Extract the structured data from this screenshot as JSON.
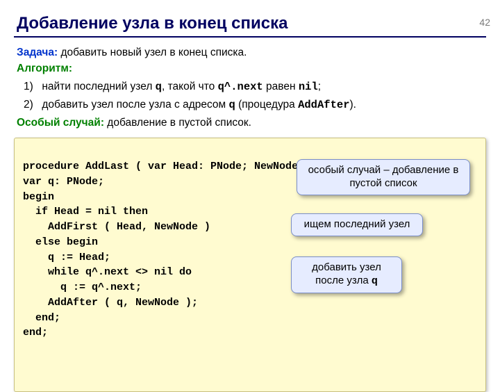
{
  "page_number": "42",
  "title": "Добавление узла в конец списка",
  "task": {
    "label": "Задача:",
    "text": " добавить новый узел в конец списка."
  },
  "algo_label": "Алгоритм:",
  "step1": {
    "num": "1)",
    "a": "найти последний узел ",
    "q": "q",
    "b": ", такой что ",
    "expr": "q^.next",
    "c": " равен ",
    "nil": "nil",
    "d": ";"
  },
  "step2": {
    "num": "2)",
    "a": "добавить узел после узла с адресом ",
    "q": "q",
    "b": " (процедура ",
    "proc": "AddAfter",
    "c": ")."
  },
  "special": {
    "label": "Особый случай:",
    "text": " добавление в пустой список."
  },
  "code": {
    "l01": "procedure AddLast ( var Head: PNode; NewNode: PNode );",
    "l02": "var q: PNode;",
    "l03": "begin",
    "l04": "  if Head = nil then",
    "l05": "    AddFirst ( Head, NewNode )",
    "l06": "  else begin",
    "l07": "    q := Head;",
    "l08": "    while q^.next <> nil do",
    "l09": "      q := q^.next;",
    "l10": "    AddAfter ( q, NewNode );",
    "l11": "  end;",
    "l12": "end;"
  },
  "callouts": {
    "c1": "особый случай – добавление в пустой список",
    "c2": "ищем последний узел",
    "c3a": "добавить узел после узла ",
    "c3q": "q"
  }
}
